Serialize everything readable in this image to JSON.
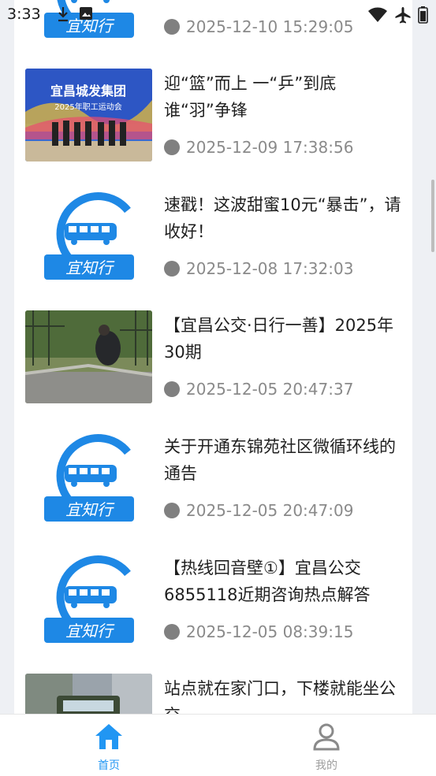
{
  "status_bar": {
    "time": "3:33"
  },
  "feed": {
    "items": [
      {
        "title": "",
        "date": "2025-12-10 15:29:05",
        "thumb": "logo"
      },
      {
        "title": "迎“篮”而上 一“乒”到底 谁“羽”争锋",
        "date": "2025-12-09 17:38:56",
        "thumb": "event-photo"
      },
      {
        "title": "速戳！这波甜蜜10元“暴击”，请收好！",
        "date": "2025-12-08 17:32:03",
        "thumb": "logo"
      },
      {
        "title": "【宜昌公交·日行一善】2025年30期",
        "date": "2025-12-05 20:47:37",
        "thumb": "garden-photo"
      },
      {
        "title": "关于开通东锦苑社区微循环线的通告",
        "date": "2025-12-05 20:47:09",
        "thumb": "logo"
      },
      {
        "title": "【热线回音壁①】宜昌公交6855118近期咨询热点解答",
        "date": "2025-12-05 08:39:15",
        "thumb": "logo"
      },
      {
        "title": "站点就在家门口，下楼就能坐公交",
        "date": "",
        "thumb": "street-photo"
      }
    ]
  },
  "logo": {
    "text": "宜知行",
    "brand_color": "#1e88e5"
  },
  "event_photo": {
    "banner": "宜昌城发集团",
    "subtitle": "2025年职工运动会"
  },
  "bottom_nav": {
    "home_label": "首页",
    "me_label": "我的",
    "active_color": "#2196f3",
    "inactive_color": "#9e9e9e"
  }
}
